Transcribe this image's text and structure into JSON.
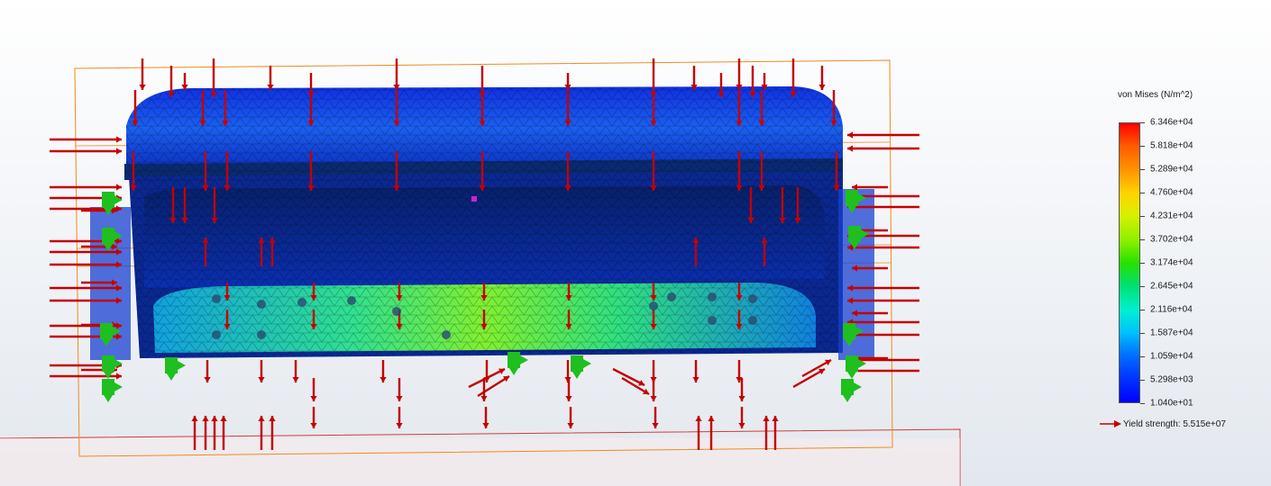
{
  "legend": {
    "title": "von Mises (N/m^2)",
    "values": [
      "6.346e+04",
      "5.818e+04",
      "5.289e+04",
      "4.760e+04",
      "4.231e+04",
      "3.702e+04",
      "3.174e+04",
      "2.645e+04",
      "2.116e+04",
      "1.587e+04",
      "1.059e+04",
      "5.298e+03",
      "1.040e+01"
    ],
    "yield_label": "Yield strength: 5.515e+07"
  },
  "colors": {
    "load_arrow": "#c40000",
    "fixture": "#1fbf1f",
    "bounding_box": "#f08a1e",
    "mesh_low": "#0a2fd0",
    "mesh_mid": "#20d040",
    "mesh_high": "#ff0000"
  },
  "icons": {
    "load_arrow": "force-arrow-icon",
    "fixture": "fixed-geometry-icon",
    "yield_marker": "yield-arrow-icon"
  }
}
